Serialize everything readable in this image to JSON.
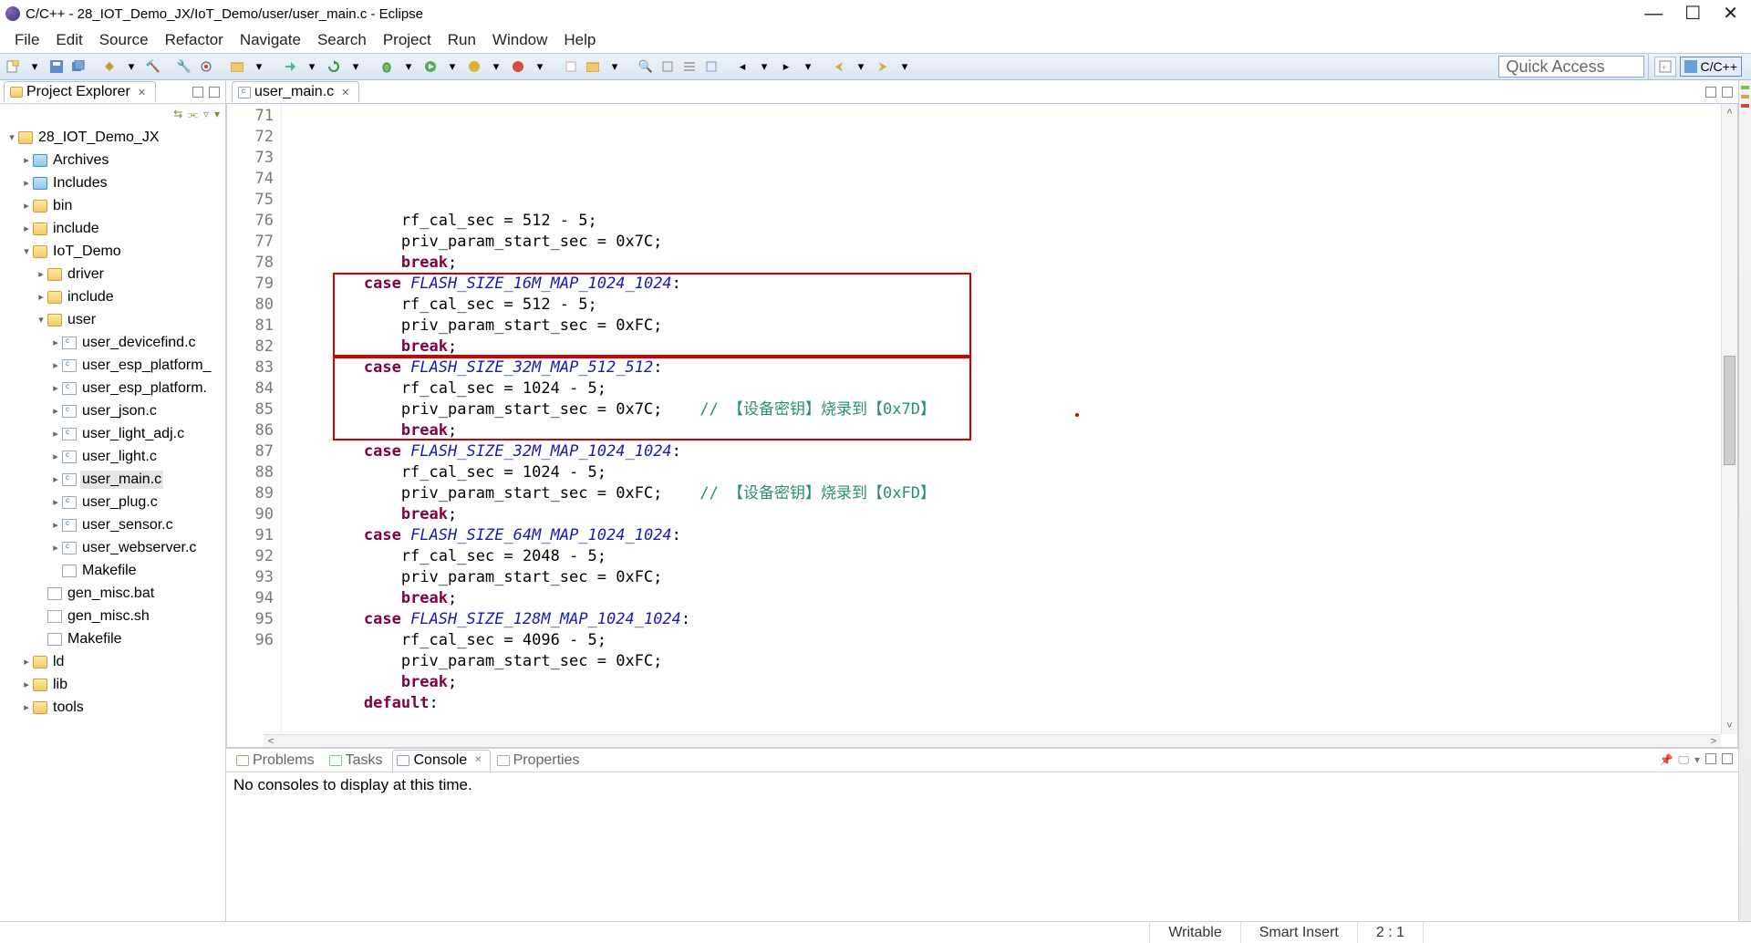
{
  "window": {
    "title": "C/C++ - 28_IOT_Demo_JX/IoT_Demo/user/user_main.c - Eclipse"
  },
  "menu": [
    "File",
    "Edit",
    "Source",
    "Refactor",
    "Navigate",
    "Search",
    "Project",
    "Run",
    "Window",
    "Help"
  ],
  "toolbar": {
    "quick_access": "Quick Access",
    "perspective": "C/C++"
  },
  "project_explorer": {
    "title": "Project Explorer"
  },
  "tree": [
    {
      "depth": 0,
      "tw": "v",
      "ic": "proj",
      "label": "28_IOT_Demo_JX"
    },
    {
      "depth": 1,
      "tw": ">",
      "ic": "fold-inc",
      "label": "Archives"
    },
    {
      "depth": 1,
      "tw": ">",
      "ic": "fold-inc",
      "label": "Includes"
    },
    {
      "depth": 1,
      "tw": ">",
      "ic": "fold",
      "label": "bin"
    },
    {
      "depth": 1,
      "tw": ">",
      "ic": "fold",
      "label": "include"
    },
    {
      "depth": 1,
      "tw": "v",
      "ic": "fold",
      "label": "IoT_Demo"
    },
    {
      "depth": 2,
      "tw": ">",
      "ic": "fold",
      "label": "driver"
    },
    {
      "depth": 2,
      "tw": ">",
      "ic": "fold",
      "label": "include"
    },
    {
      "depth": 2,
      "tw": "v",
      "ic": "fold",
      "label": "user"
    },
    {
      "depth": 3,
      "tw": ">",
      "ic": "cfile",
      "label": "user_devicefind.c"
    },
    {
      "depth": 3,
      "tw": ">",
      "ic": "cfile",
      "label": "user_esp_platform_"
    },
    {
      "depth": 3,
      "tw": ">",
      "ic": "cfile",
      "label": "user_esp_platform."
    },
    {
      "depth": 3,
      "tw": ">",
      "ic": "cfile",
      "label": "user_json.c"
    },
    {
      "depth": 3,
      "tw": ">",
      "ic": "cfile",
      "label": "user_light_adj.c"
    },
    {
      "depth": 3,
      "tw": ">",
      "ic": "cfile",
      "label": "user_light.c"
    },
    {
      "depth": 3,
      "tw": ">",
      "ic": "cfile",
      "label": "user_main.c",
      "selected": true
    },
    {
      "depth": 3,
      "tw": ">",
      "ic": "cfile",
      "label": "user_plug.c"
    },
    {
      "depth": 3,
      "tw": ">",
      "ic": "cfile",
      "label": "user_sensor.c"
    },
    {
      "depth": 3,
      "tw": ">",
      "ic": "cfile",
      "label": "user_webserver.c"
    },
    {
      "depth": 3,
      "tw": "",
      "ic": "file",
      "label": "Makefile"
    },
    {
      "depth": 2,
      "tw": "",
      "ic": "file",
      "label": "gen_misc.bat"
    },
    {
      "depth": 2,
      "tw": "",
      "ic": "file",
      "label": "gen_misc.sh"
    },
    {
      "depth": 2,
      "tw": "",
      "ic": "file",
      "label": "Makefile"
    },
    {
      "depth": 1,
      "tw": ">",
      "ic": "fold",
      "label": "ld"
    },
    {
      "depth": 1,
      "tw": ">",
      "ic": "fold",
      "label": "lib"
    },
    {
      "depth": 1,
      "tw": ">",
      "ic": "fold",
      "label": "tools"
    }
  ],
  "editor": {
    "tab": "user_main.c",
    "first_line_no": 71,
    "lines": [
      [
        {
          "t": "            rf_cal_sec = 512 - 5;",
          "c": ""
        }
      ],
      [
        {
          "t": "            priv_param_start_sec = 0x7C;",
          "c": ""
        }
      ],
      [
        {
          "t": "            ",
          "c": ""
        },
        {
          "t": "break",
          "c": "kw"
        },
        {
          "t": ";",
          "c": ""
        }
      ],
      [
        {
          "t": "        ",
          "c": ""
        },
        {
          "t": "case",
          "c": "kw"
        },
        {
          "t": " ",
          "c": ""
        },
        {
          "t": "FLASH_SIZE_16M_MAP_1024_1024",
          "c": "const-id"
        },
        {
          "t": ":",
          "c": ""
        }
      ],
      [
        {
          "t": "            rf_cal_sec = 512 - 5;",
          "c": ""
        }
      ],
      [
        {
          "t": "            priv_param_start_sec = 0xFC;",
          "c": ""
        }
      ],
      [
        {
          "t": "            ",
          "c": ""
        },
        {
          "t": "break",
          "c": "kw"
        },
        {
          "t": ";",
          "c": ""
        }
      ],
      [
        {
          "t": "",
          "c": ""
        }
      ],
      [
        {
          "t": "        ",
          "c": ""
        },
        {
          "t": "case",
          "c": "kw"
        },
        {
          "t": " ",
          "c": ""
        },
        {
          "t": "FLASH_SIZE_32M_MAP_512_512",
          "c": "const-id"
        },
        {
          "t": ":",
          "c": ""
        }
      ],
      [
        {
          "t": "            rf_cal_sec = 1024 - 5;",
          "c": ""
        }
      ],
      [
        {
          "t": "            priv_param_start_sec = 0x7C;    ",
          "c": ""
        },
        {
          "t": "// 【设备密钥】烧录到【0x7D】",
          "c": "cmt"
        }
      ],
      [
        {
          "t": "            ",
          "c": ""
        },
        {
          "t": "break",
          "c": "kw"
        },
        {
          "t": ";",
          "c": ""
        }
      ],
      [
        {
          "t": "        ",
          "c": ""
        },
        {
          "t": "case",
          "c": "kw"
        },
        {
          "t": " ",
          "c": ""
        },
        {
          "t": "FLASH_SIZE_32M_MAP_1024_1024",
          "c": "const-id"
        },
        {
          "t": ":",
          "c": ""
        }
      ],
      [
        {
          "t": "            rf_cal_sec = 1024 - 5;",
          "c": ""
        }
      ],
      [
        {
          "t": "            priv_param_start_sec = 0xFC;    ",
          "c": ""
        },
        {
          "t": "// 【设备密钥】烧录到【0xFD】",
          "c": "cmt"
        }
      ],
      [
        {
          "t": "            ",
          "c": ""
        },
        {
          "t": "break",
          "c": "kw"
        },
        {
          "t": ";",
          "c": ""
        }
      ],
      [
        {
          "t": "",
          "c": ""
        }
      ],
      [
        {
          "t": "        ",
          "c": ""
        },
        {
          "t": "case",
          "c": "kw"
        },
        {
          "t": " ",
          "c": ""
        },
        {
          "t": "FLASH_SIZE_64M_MAP_1024_1024",
          "c": "const-id"
        },
        {
          "t": ":",
          "c": ""
        }
      ],
      [
        {
          "t": "            rf_cal_sec = 2048 - 5;",
          "c": ""
        }
      ],
      [
        {
          "t": "            priv_param_start_sec = 0xFC;",
          "c": ""
        }
      ],
      [
        {
          "t": "            ",
          "c": ""
        },
        {
          "t": "break",
          "c": "kw"
        },
        {
          "t": ";",
          "c": ""
        }
      ],
      [
        {
          "t": "        ",
          "c": ""
        },
        {
          "t": "case",
          "c": "kw"
        },
        {
          "t": " ",
          "c": ""
        },
        {
          "t": "FLASH_SIZE_128M_MAP_1024_1024",
          "c": "const-id"
        },
        {
          "t": ":",
          "c": ""
        }
      ],
      [
        {
          "t": "            rf_cal_sec = 4096 - 5;",
          "c": ""
        }
      ],
      [
        {
          "t": "            priv_param_start_sec = 0xFC;",
          "c": ""
        }
      ],
      [
        {
          "t": "            ",
          "c": ""
        },
        {
          "t": "break",
          "c": "kw"
        },
        {
          "t": ";",
          "c": ""
        }
      ],
      [
        {
          "t": "        ",
          "c": ""
        },
        {
          "t": "default",
          "c": "kw"
        },
        {
          "t": ":",
          "c": ""
        }
      ]
    ]
  },
  "bottom": {
    "tabs": [
      "Problems",
      "Tasks",
      "Console",
      "Properties"
    ],
    "active": 2,
    "console_msg": "No consoles to display at this time."
  },
  "status": {
    "writable": "Writable",
    "insert": "Smart Insert",
    "pos": "2 : 1"
  }
}
